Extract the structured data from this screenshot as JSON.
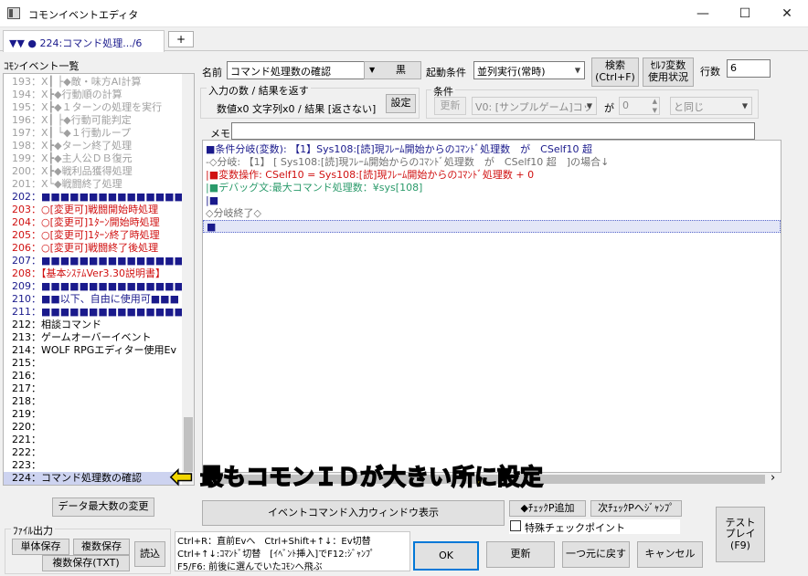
{
  "window": {
    "title": "コモンイベントエディタ",
    "minimize_glyph": "—",
    "maximize_glyph": "☐",
    "close_glyph": "✕"
  },
  "tabs": {
    "active_label": "▼▼ ● 224:コマンド処理.../6",
    "add_label": "+"
  },
  "common_list": {
    "label": "ｺﾓﾝイベント一覧",
    "items": [
      {
        "num": "193",
        "text": "：X┃ ├◆敵・味方AI計算",
        "color": "#a0a0a0"
      },
      {
        "num": "194",
        "text": "：X┣◆行動順の計算",
        "color": "#a0a0a0"
      },
      {
        "num": "195",
        "text": "：X┣◆１ターンの処理を実行",
        "color": "#a0a0a0"
      },
      {
        "num": "196",
        "text": "：X┃ ├◆行動可能判定",
        "color": "#a0a0a0"
      },
      {
        "num": "197",
        "text": "：X┃ └◆１行動ループ",
        "color": "#a0a0a0"
      },
      {
        "num": "198",
        "text": "：X┣◆ターン終了処理",
        "color": "#a0a0a0"
      },
      {
        "num": "199",
        "text": "：X┣◆主人公ＤＢ復元",
        "color": "#a0a0a0"
      },
      {
        "num": "200",
        "text": "：X┣◆戦利品獲得処理",
        "color": "#a0a0a0"
      },
      {
        "num": "201",
        "text": "：X└◆戦闘終了処理",
        "color": "#a0a0a0"
      },
      {
        "num": "202",
        "text": "：■■■■■■■■■■■■■■■■■",
        "color": "#1a1a8c"
      },
      {
        "num": "203",
        "text": "：○[変更可]戦闘開始時処理",
        "color": "#d01010"
      },
      {
        "num": "204",
        "text": "：○[変更可]1ﾀｰﾝ開始時処理",
        "color": "#d01010"
      },
      {
        "num": "205",
        "text": "：○[変更可]1ﾀｰﾝ終了時処理",
        "color": "#d01010"
      },
      {
        "num": "206",
        "text": "：○[変更可]戦闘終了後処理",
        "color": "#d01010"
      },
      {
        "num": "207",
        "text": "：■■■■■■■■■■■■■■■■■",
        "color": "#1a1a8c"
      },
      {
        "num": "208",
        "text": "：【基本ｼｽﾃﾑVer3.30説明書】",
        "color": "#d01010"
      },
      {
        "num": "209",
        "text": "：■■■■■■■■■■■■■■■■■",
        "color": "#1a1a8c"
      },
      {
        "num": "210",
        "text": "：■■以下、自由に使用可■■■",
        "color": "#1a1a8c"
      },
      {
        "num": "211",
        "text": "：■■■■■■■■■■■■■■■■■",
        "color": "#1a1a8c"
      },
      {
        "num": "212",
        "text": "：相談コマンド",
        "color": "#000000"
      },
      {
        "num": "213",
        "text": "：ゲームオーバーイベント",
        "color": "#000000"
      },
      {
        "num": "214",
        "text": "：WOLF RPGエディター使用Ev",
        "color": "#000000"
      },
      {
        "num": "215",
        "text": "：",
        "color": "#000000"
      },
      {
        "num": "216",
        "text": "：",
        "color": "#000000"
      },
      {
        "num": "217",
        "text": "：",
        "color": "#000000"
      },
      {
        "num": "218",
        "text": "：",
        "color": "#000000"
      },
      {
        "num": "219",
        "text": "：",
        "color": "#000000"
      },
      {
        "num": "220",
        "text": "：",
        "color": "#000000"
      },
      {
        "num": "221",
        "text": "：",
        "color": "#000000"
      },
      {
        "num": "222",
        "text": "：",
        "color": "#000000"
      },
      {
        "num": "223",
        "text": "：",
        "color": "#000000"
      },
      {
        "num": "224",
        "text": "：コマンド処理数の確認",
        "color": "#000000"
      }
    ],
    "selected_index": 31
  },
  "props": {
    "name_label": "名前",
    "name_value": "コマンド処理数の確認",
    "color_button": "黒",
    "trigger_label": "起動条件",
    "trigger_value": "並列実行(常時)",
    "search_button": "検索\n(Ctrl+F)",
    "self_var_button": "ｾﾙﾌ変数\n使用状況",
    "lines_label": "行数",
    "lines_value": "6",
    "io_group_title": "入力の数 / 結果を返す",
    "io_summary": "数値x0 文字列x0 / 結果 [返さない]",
    "io_set_button": "設定",
    "cond_group_title": "条件",
    "cond_update_button": "更新",
    "cond_var_value": "V0: [サンプルゲーム]コッ",
    "cond_ga": "が",
    "cond_num_value": "0",
    "cond_op_value": "と同じ",
    "memo_label": "メモ",
    "memo_value": ""
  },
  "code_lines": [
    {
      "text": "■条件分岐(変数): 【1】Sys108:[読]現ﾌﾚｰﾑ開始からのｺﾏﾝﾄﾞ処理数　が　CSelf10 超",
      "color": "#1a1a8c"
    },
    {
      "text": "-◇分岐: 【1】 [ Sys108:[読]現ﾌﾚｰﾑ開始からのｺﾏﾝﾄﾞ処理数　が　CSelf10 超　]の場合↓",
      "color": "#707070"
    },
    {
      "text": " |■変数操作: CSelf10 = Sys108:[読]現ﾌﾚｰﾑ開始からのｺﾏﾝﾄﾞ処理数 + 0",
      "color": "#d01010"
    },
    {
      "text": " |■デバッグ文:最大コマンド処理数：¥sys[108]",
      "color": "#2a9a6a"
    },
    {
      "text": " |■",
      "color": "#1a1a8c"
    },
    {
      "text": "◇分岐終了◇",
      "color": "#707070"
    },
    {
      "text": "■",
      "color": "#1a1a8c"
    }
  ],
  "annotation": {
    "text": "最もコモンＩＤが大きい所に設定"
  },
  "bottom": {
    "data_max_button": "データ最大数の変更",
    "file_group_title": "ﾌｧｲﾙ出力",
    "single_save": "単体保存",
    "multi_save": "複数保存",
    "multi_save_txt": "複数保存(TXT)",
    "load": "読込",
    "event_cmd_button": "イベントコマンド入力ウィンドウ表示",
    "checkp_add": "◆ﾁｪｯｸP追加",
    "checkp_next": "次ﾁｪｯｸPへｼﾞｬﾝﾌﾟ",
    "special_check": "特殊チェックポイント",
    "help_line1": "Ctrl+R：直前Evへ　Ctrl+Shift+↑↓：Ev切替",
    "help_line2": "Ctrl+↑↓:ｺﾏﾝﾄﾞ切替　[ｲﾍﾞﾝﾄ挿入]でF12:ｼﾞｬﾝﾌﾟ",
    "help_line3": "F5/F6: 前後に選んでいたｺﾓﾝへ飛ぶ",
    "ok": "OK",
    "update": "更新",
    "undo": "一つ元に戻す",
    "cancel": "キャンセル",
    "testplay": "テスト\nプレイ\n(F9)"
  }
}
